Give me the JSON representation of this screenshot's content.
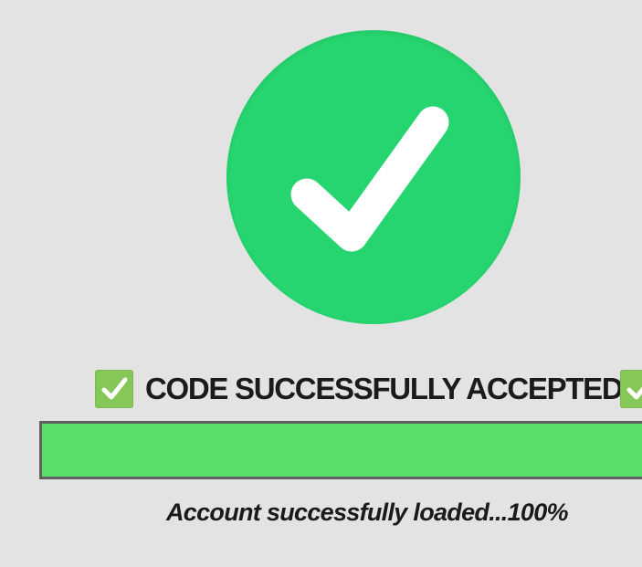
{
  "success_icon": {
    "name": "checkmark-icon",
    "circle_color": "#26d56f",
    "check_color": "#ffffff"
  },
  "status": {
    "left_icon": "check-mark-button-icon",
    "text": "CODE SUCCESSFULLY ACCEPTED",
    "right_icon": "check-mark-button-icon",
    "badge_color": "#86c857"
  },
  "progress": {
    "percent": 100,
    "fill_color": "#58e06a",
    "caption": "Account successfully loaded...100%"
  }
}
